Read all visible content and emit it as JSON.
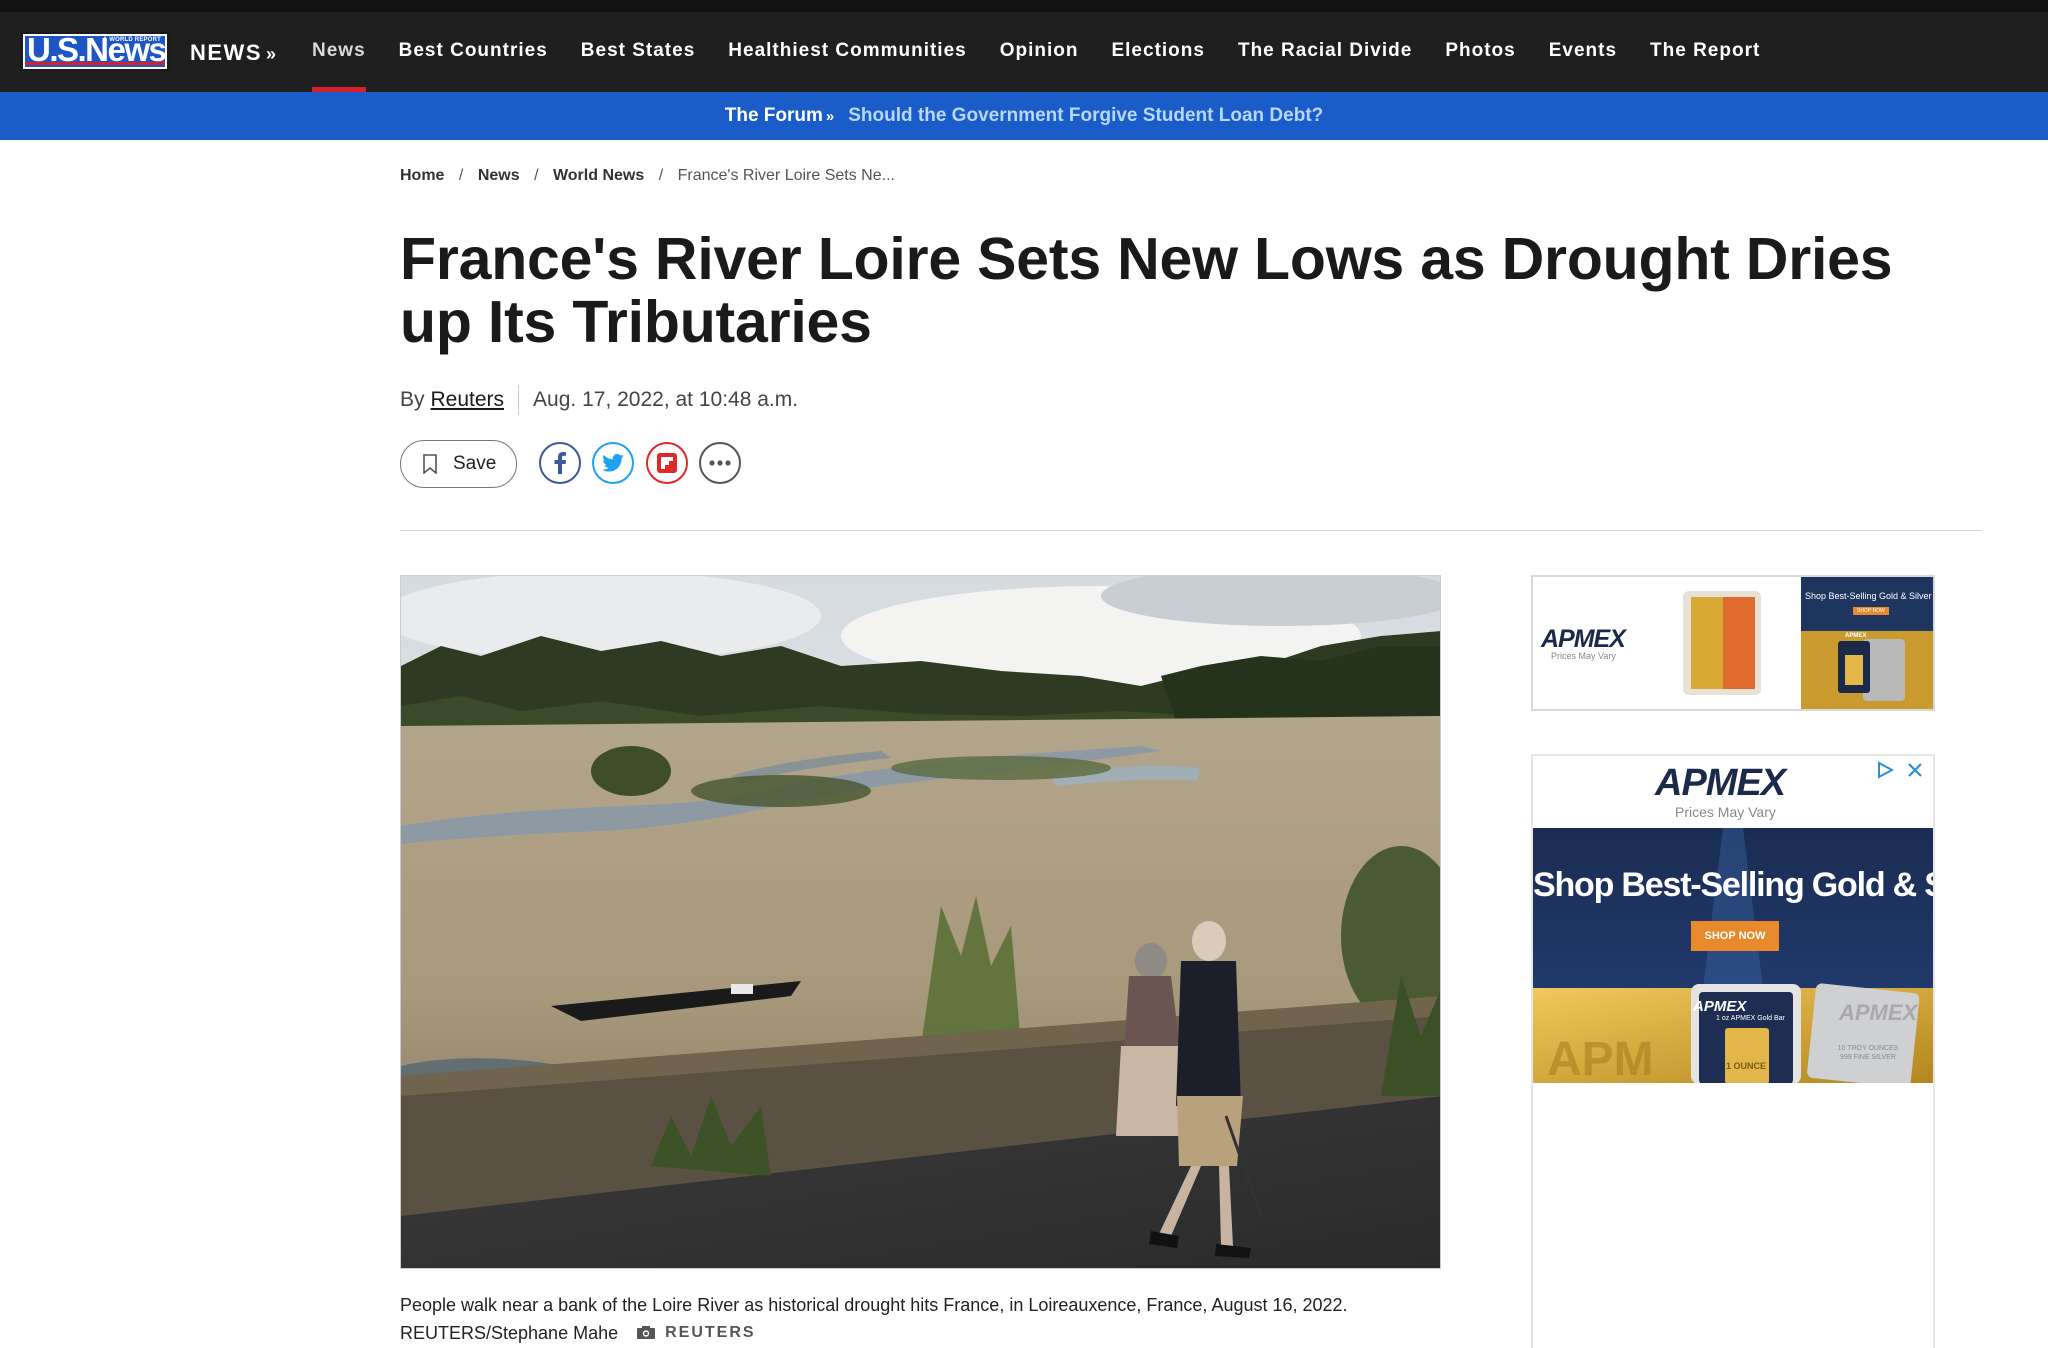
{
  "brand": {
    "logo_text": "U.S.News",
    "logo_small": "& WORLD REPORT",
    "section": "NEWS",
    "section_suffix": "»"
  },
  "nav": {
    "items": [
      {
        "label": "News",
        "active": true
      },
      {
        "label": "Best Countries"
      },
      {
        "label": "Best States"
      },
      {
        "label": "Healthiest Communities"
      },
      {
        "label": "Opinion"
      },
      {
        "label": "Elections"
      },
      {
        "label": "The Racial Divide"
      },
      {
        "label": "Photos"
      },
      {
        "label": "Events"
      },
      {
        "label": "The Report"
      }
    ]
  },
  "forum": {
    "label": "The Forum",
    "suffix": "»",
    "link": "Should the Government Forgive Student Loan Debt?"
  },
  "breadcrumb": {
    "items": [
      "Home",
      "News",
      "World News"
    ],
    "separator": "/",
    "current": "France's River Loire Sets Ne..."
  },
  "article": {
    "headline": "France's River Loire Sets New Lows as Drought Dries up Its Tributaries",
    "by_prefix": "By",
    "author": "Reuters",
    "date": "Aug. 17, 2022, at 10:48 a.m."
  },
  "share": {
    "save_label": "Save",
    "icons": [
      "facebook-icon",
      "twitter-icon",
      "flipboard-icon",
      "more-icon"
    ]
  },
  "caption": {
    "text": "People walk near a bank of the Loire River as historical drought hits France, in Loireauxence, France, August 16, 2022. REUTERS/Stephane Mahe",
    "credit": "REUTERS"
  },
  "ads": {
    "small": {
      "brand": "APMEX",
      "sub": "Prices May Vary",
      "headline": "Shop Best-Selling Gold & Silver",
      "cta": "SHOP NOW",
      "mini_brand": "APMEX"
    },
    "large": {
      "brand": "APMEX",
      "sub": "Prices May Vary",
      "headline": "Shop Best-Selling Gold & Silver",
      "cta": "SHOP NOW",
      "bar_brand": "APMEX",
      "bar_label": "1 oz APMEX Gold Bar",
      "bar_text": "1 OUNCE",
      "silver_brand": "APMEX",
      "silver_label": "10 TROY OUNCES 999 FINE SILVER",
      "gold_stamp": "APM"
    }
  },
  "colors": {
    "nav_bg": "#1f1f1f",
    "forum_bg": "#1a5cc8",
    "accent_red": "#d3202a",
    "link_blue": "#b8d7ff"
  }
}
